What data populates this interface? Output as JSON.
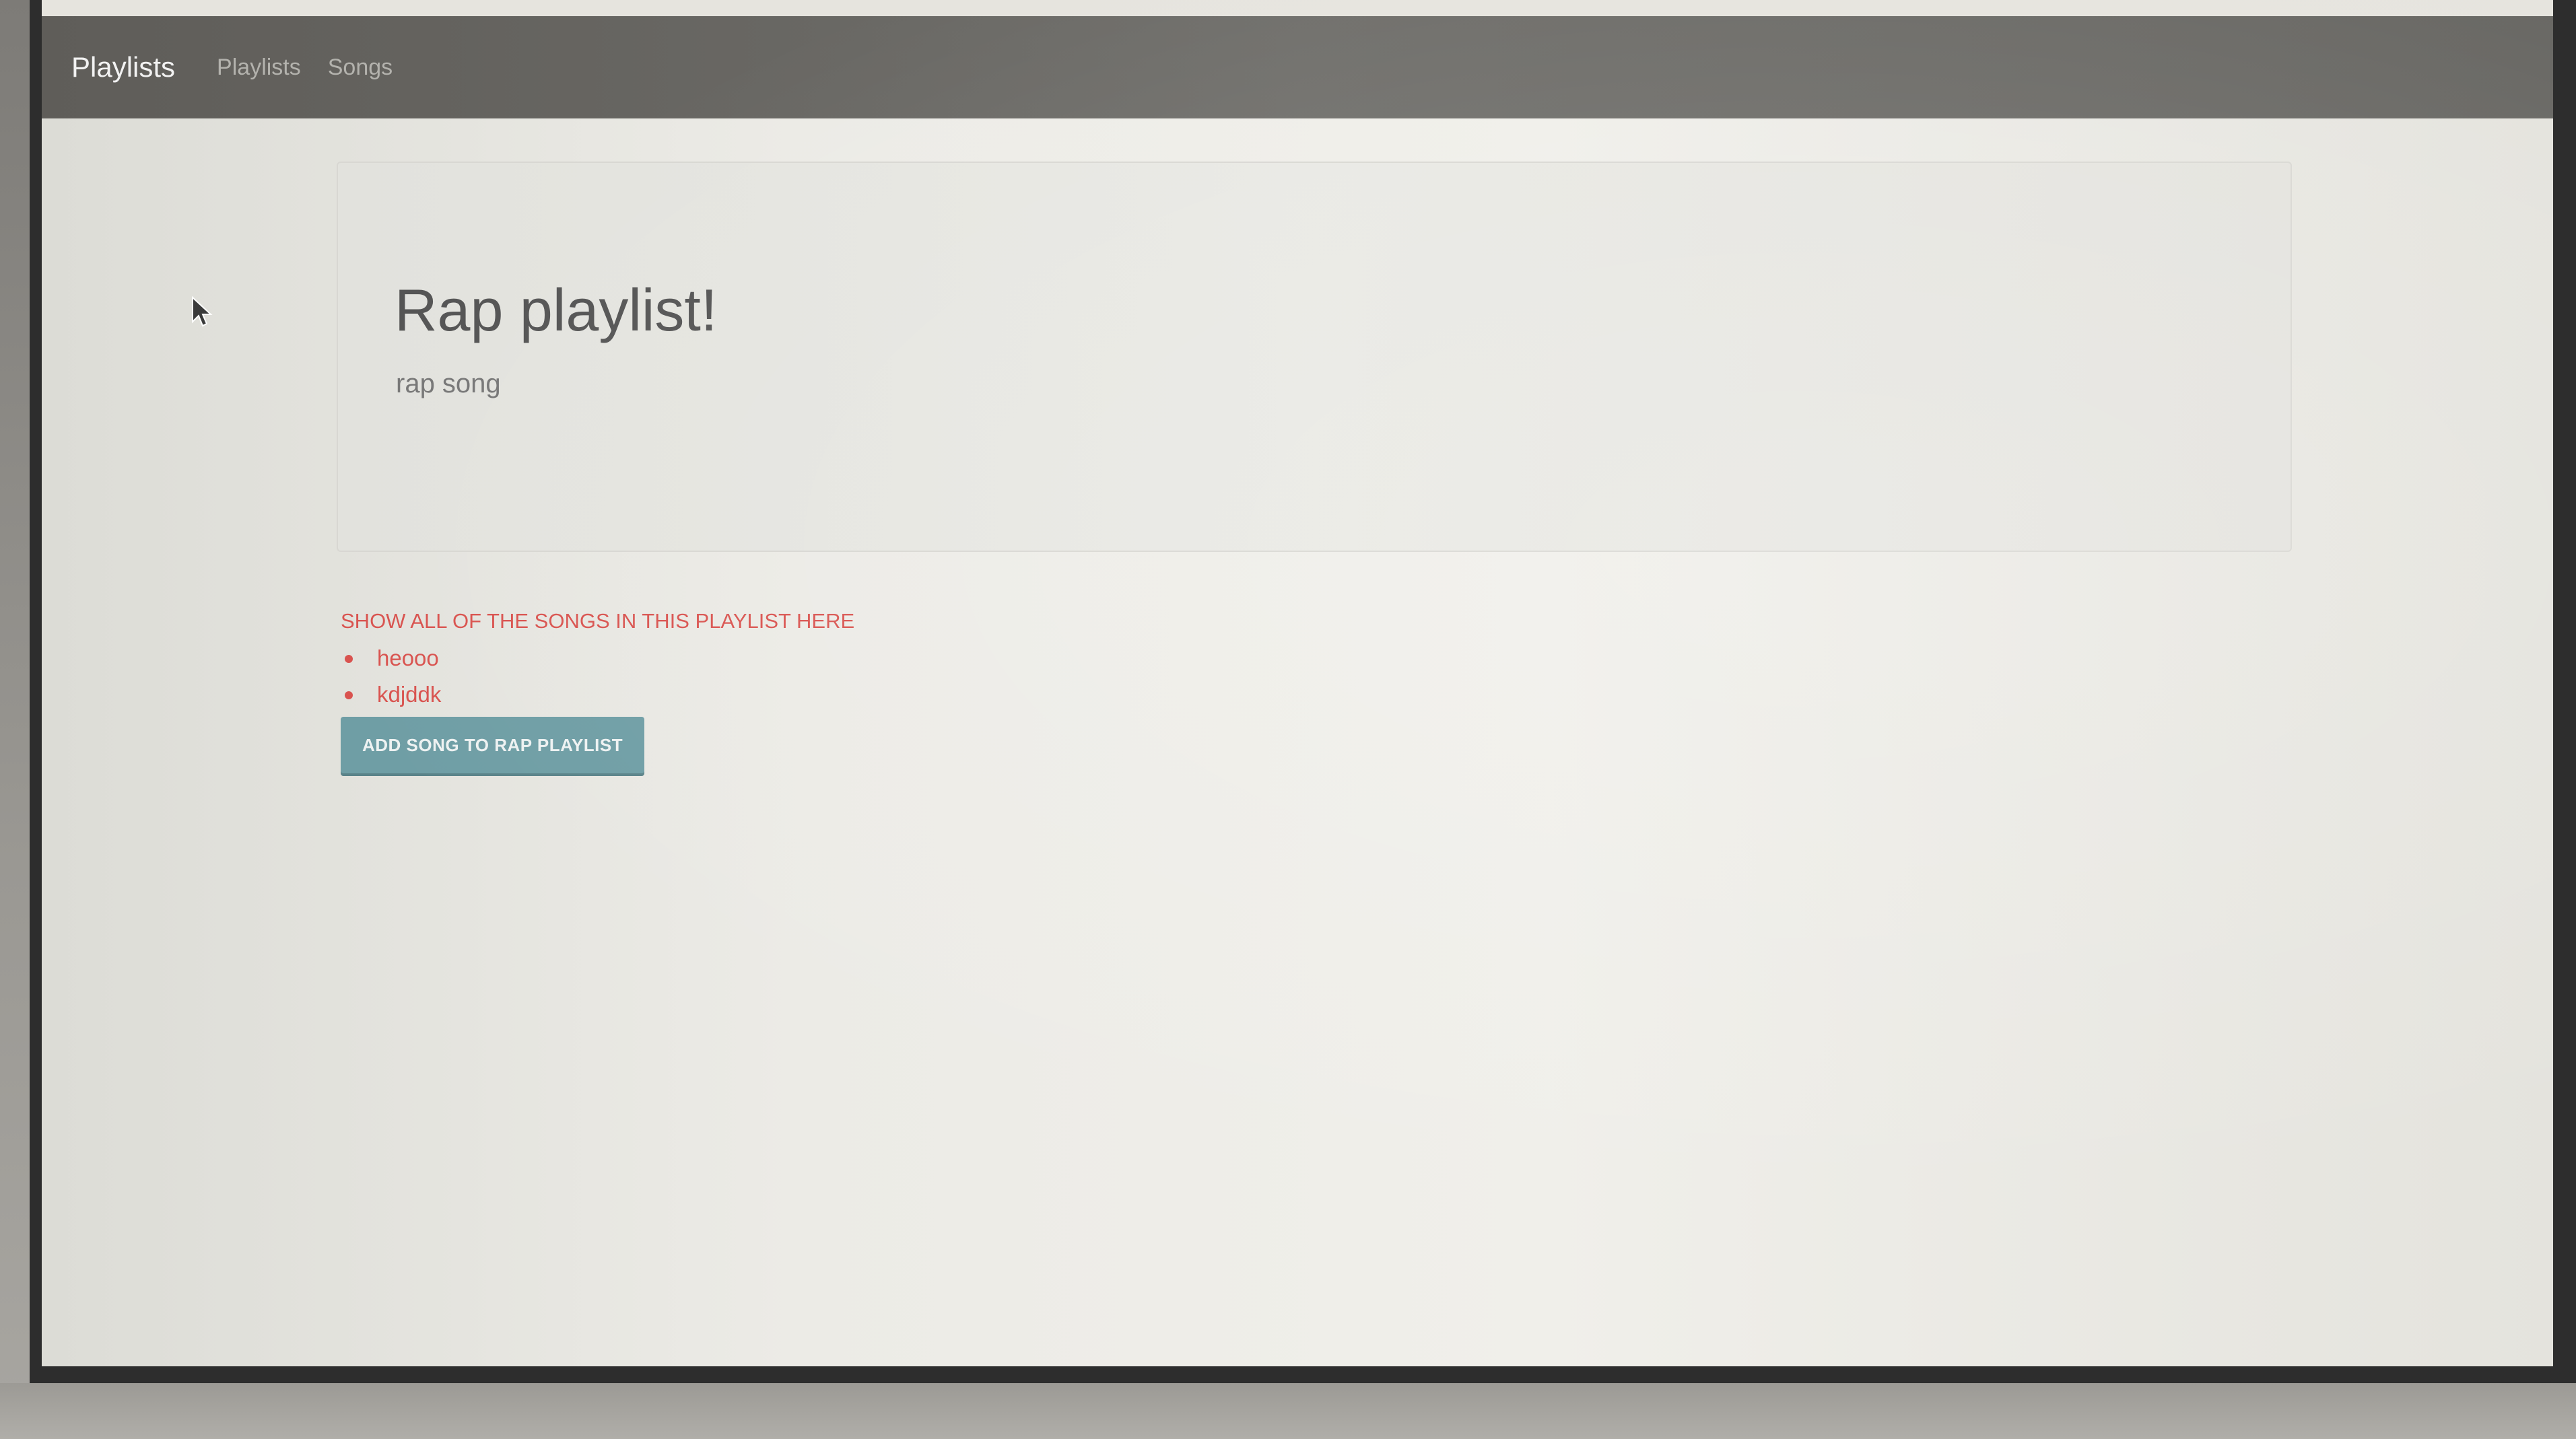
{
  "navbar": {
    "brand": "Playlists",
    "links": [
      {
        "label": "Playlists"
      },
      {
        "label": "Songs"
      }
    ]
  },
  "jumbotron": {
    "title": "Rap playlist!",
    "subtitle": "rap song"
  },
  "songs_section": {
    "heading": "SHOW ALL OF THE SONGS IN THIS PLAYLIST HERE",
    "songs": [
      {
        "name": "heooo"
      },
      {
        "name": "kdjddk"
      }
    ],
    "add_button_label": "ADD SONG TO RAP PLAYLIST"
  },
  "colors": {
    "navbar": "#676662",
    "accent_red": "#d9534f",
    "button": "#6f9ea5"
  }
}
